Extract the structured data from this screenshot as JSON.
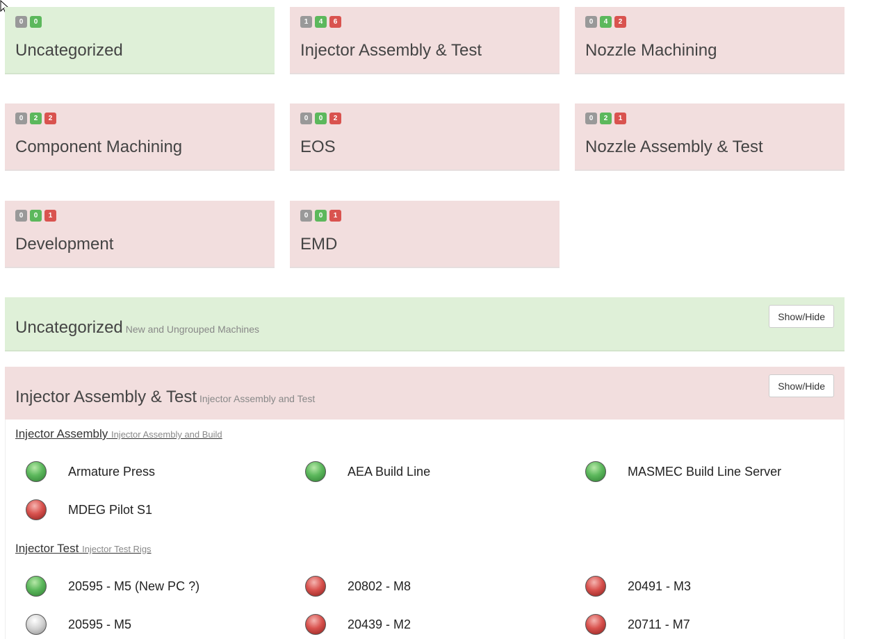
{
  "tiles": [
    {
      "title": "Uncategorized",
      "counts": [
        "0",
        "0"
      ]
    },
    {
      "title": "Injector Assembly & Test",
      "counts": [
        "1",
        "4",
        "6"
      ]
    },
    {
      "title": "Nozzle Machining",
      "counts": [
        "0",
        "4",
        "2"
      ]
    },
    {
      "title": "Component Machining",
      "counts": [
        "0",
        "2",
        "2"
      ]
    },
    {
      "title": "EOS",
      "counts": [
        "0",
        "0",
        "2"
      ]
    },
    {
      "title": "Nozzle Assembly & Test",
      "counts": [
        "0",
        "2",
        "1"
      ]
    },
    {
      "title": "Development",
      "counts": [
        "0",
        "0",
        "1"
      ]
    },
    {
      "title": "EMD",
      "counts": [
        "0",
        "0",
        "1"
      ]
    }
  ],
  "panels": {
    "uncategorized": {
      "title": "Uncategorized",
      "subtitle": "New and Ungrouped Machines",
      "button": "Show/Hide"
    },
    "injector": {
      "title": "Injector Assembly & Test",
      "subtitle": "Injector Assembly and Test",
      "button": "Show/Hide"
    }
  },
  "groups": {
    "assembly": {
      "title": "Injector Assembly",
      "subtitle": "Injector Assembly and Build",
      "machines": [
        {
          "name": "Armature Press",
          "status": "green"
        },
        {
          "name": "AEA Build Line",
          "status": "green"
        },
        {
          "name": "MASMEC Build Line Server",
          "status": "green"
        },
        {
          "name": "MDEG Pilot S1",
          "status": "red"
        }
      ]
    },
    "test": {
      "title": "Injector Test",
      "subtitle": "Injector Test Rigs",
      "machines": [
        {
          "name": "20595 - M5 (New PC ?)",
          "status": "green"
        },
        {
          "name": "20802 - M8",
          "status": "red"
        },
        {
          "name": "20491 - M3",
          "status": "red"
        },
        {
          "name": "20595 - M5",
          "status": "grey"
        },
        {
          "name": "20439 - M2",
          "status": "red"
        },
        {
          "name": "20711 - M7",
          "status": "red"
        }
      ]
    }
  },
  "colors": {
    "ok": "#5cb85c",
    "error": "#d9534f",
    "unknown": "#999999",
    "ok_bg": "#dff0d8",
    "error_bg": "#f2dede"
  }
}
